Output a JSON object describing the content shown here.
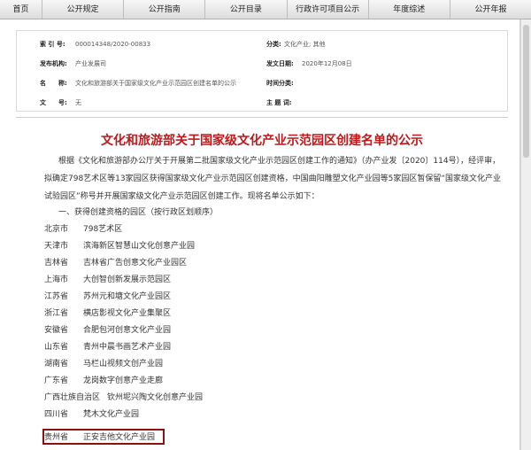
{
  "nav": [
    "首页",
    "公开规定",
    "公开指南",
    "公开目录",
    "行政许可项目公示",
    "年度综述",
    "公开年报"
  ],
  "meta": {
    "index_label": "索 引 号:",
    "index_value": "000014348/2020-00833",
    "category_label": "分类:",
    "category_value": "文化产业; 其他",
    "issuer_label": "发布机构:",
    "issuer_value": "产业发展司",
    "date_label": "发文日期:",
    "date_value": "2020年12月08日",
    "name_label": "名　　称:",
    "name_value": "文化和旅游部关于国家级文化产业示范园区创建名单的公示",
    "topic_label": "时间分类:",
    "topic_value": "",
    "docno_label": "文　　号:",
    "docno_value": "无",
    "subject_label": "主 题 词:",
    "subject_value": ""
  },
  "title": "文化和旅游部关于国家级文化产业示范园区创建名单的公示",
  "intro": "根据《文化和旅游部办公厅关于开展第二批国家级文化产业示范园区创建工作的通知》（办产业发〔2020〕114号），经评审，拟确定798艺术区等13家园区获得国家级文化产业示范园区创建资格，中国曲阳雕塑文化产业园等5家园区暂保留“国家级文化产业试验园区”称号并开展国家级文化产业示范园区创建工作。现将名单公示如下：",
  "section": "一、获得创建资格的园区（按行政区划顺序）",
  "parks": [
    {
      "province": "北京市",
      "name": "798艺术区"
    },
    {
      "province": "天津市",
      "name": "滨海新区智慧山文化创意产业园"
    },
    {
      "province": "吉林省",
      "name": "吉林省广告创意文化产业园区"
    },
    {
      "province": "上海市",
      "name": "大创智创新发展示范园区"
    },
    {
      "province": "江苏省",
      "name": "苏州元和塘文化产业园区"
    },
    {
      "province": "浙江省",
      "name": "横店影视文化产业集聚区"
    },
    {
      "province": "安徽省",
      "name": "合肥包河创意文化产业园"
    },
    {
      "province": "山东省",
      "name": "青州中晨书画艺术产业园"
    },
    {
      "province": "湖南省",
      "name": "马栏山视频文创产业园"
    },
    {
      "province": "广东省",
      "name": "龙岗数字创意产业走廊"
    },
    {
      "province": "广西壮族自治区",
      "name": "钦州坭兴陶文化创意产业园"
    },
    {
      "province": "四川省",
      "name": "梵木文化产业园"
    },
    {
      "province": "贵州省",
      "name": "正安吉他文化产业园"
    }
  ]
}
